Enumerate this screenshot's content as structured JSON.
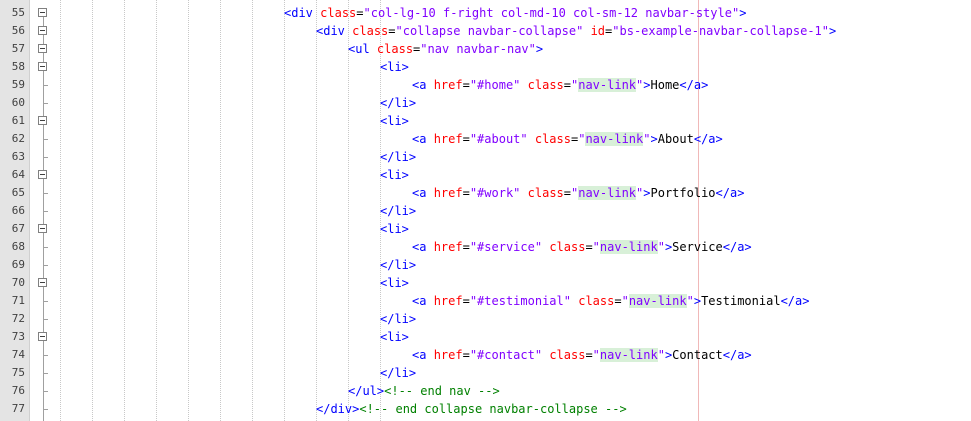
{
  "editor": {
    "lines": [
      {
        "num": "55",
        "fold": "box",
        "indent": 284,
        "html": "<span class='tag'>&lt;div</span> <span class='attr'>class</span><span class='txt'>=</span><span class='val'>\"col-lg-10 f-right col-md-10 col-sm-12 navbar-style\"</span><span class='tag'>&gt;</span>"
      },
      {
        "num": "56",
        "fold": "box",
        "indent": 316,
        "html": "<span class='tag'>&lt;div</span> <span class='attr'>class</span><span class='txt'>=</span><span class='val'>\"collapse navbar-collapse\"</span> <span class='attr'>id</span><span class='txt'>=</span><span class='val'>\"bs-example-navbar-collapse-1\"</span><span class='tag'>&gt;</span>"
      },
      {
        "num": "57",
        "fold": "box",
        "indent": 348,
        "html": "<span class='tag'>&lt;ul</span> <span class='attr'>class</span><span class='txt'>=</span><span class='val'>\"nav navbar-nav\"</span><span class='tag'>&gt;</span>"
      },
      {
        "num": "58",
        "fold": "box",
        "indent": 380,
        "html": "<span class='tag'>&lt;li&gt;</span>"
      },
      {
        "num": "59",
        "fold": "tick",
        "indent": 412,
        "html": "<span class='tag'>&lt;a</span> <span class='attr'>href</span><span class='txt'>=</span><span class='val'>\"#home\"</span> <span class='attr'>class</span><span class='txt'>=</span><span class='val'>\"<span class='hl'>nav-link</span>\"</span><span class='tag'>&gt;</span><span class='txt'>Home</span><span class='tag'>&lt;/a&gt;</span>"
      },
      {
        "num": "60",
        "fold": "tick",
        "indent": 380,
        "html": "<span class='tag'>&lt;/li&gt;</span>"
      },
      {
        "num": "61",
        "fold": "box",
        "indent": 380,
        "html": "<span class='tag'>&lt;li&gt;</span>"
      },
      {
        "num": "62",
        "fold": "tick",
        "indent": 412,
        "html": "<span class='tag'>&lt;a</span> <span class='attr'>href</span><span class='txt'>=</span><span class='val'>\"#about\"</span> <span class='attr'>class</span><span class='txt'>=</span><span class='val'>\"<span class='hl'>nav-link</span>\"</span><span class='tag'>&gt;</span><span class='txt'>About</span><span class='tag'>&lt;/a&gt;</span>"
      },
      {
        "num": "63",
        "fold": "tick",
        "indent": 380,
        "html": "<span class='tag'>&lt;/li&gt;</span>"
      },
      {
        "num": "64",
        "fold": "box",
        "indent": 380,
        "html": "<span class='tag'>&lt;li&gt;</span>"
      },
      {
        "num": "65",
        "fold": "tick",
        "indent": 412,
        "html": "<span class='tag'>&lt;a</span> <span class='attr'>href</span><span class='txt'>=</span><span class='val'>\"#work\"</span> <span class='attr'>class</span><span class='txt'>=</span><span class='val'>\"<span class='hl'>nav-link</span>\"</span><span class='tag'>&gt;</span><span class='txt'>Portfolio</span><span class='tag'>&lt;/a&gt;</span>"
      },
      {
        "num": "66",
        "fold": "tick",
        "indent": 380,
        "html": "<span class='tag'>&lt;/li&gt;</span>"
      },
      {
        "num": "67",
        "fold": "box",
        "indent": 380,
        "html": "<span class='tag'>&lt;li&gt;</span>"
      },
      {
        "num": "68",
        "fold": "tick",
        "indent": 412,
        "html": "<span class='tag'>&lt;a</span> <span class='attr'>href</span><span class='txt'>=</span><span class='val'>\"#service\"</span> <span class='attr'>class</span><span class='txt'>=</span><span class='val'>\"<span class='hl'>nav-link</span>\"</span><span class='tag'>&gt;</span><span class='txt'>Service</span><span class='tag'>&lt;/a&gt;</span>"
      },
      {
        "num": "69",
        "fold": "tick",
        "indent": 380,
        "html": "<span class='tag'>&lt;/li&gt;</span>"
      },
      {
        "num": "70",
        "fold": "box",
        "indent": 380,
        "html": "<span class='tag'>&lt;li&gt;</span>"
      },
      {
        "num": "71",
        "fold": "tick",
        "indent": 412,
        "html": "<span class='tag'>&lt;a</span> <span class='attr'>href</span><span class='txt'>=</span><span class='val'>\"#testimonial\"</span> <span class='attr'>class</span><span class='txt'>=</span><span class='val'>\"<span class='hl'>nav-link</span>\"</span><span class='tag'>&gt;</span><span class='txt'>Testimonial</span><span class='tag'>&lt;/a&gt;</span>"
      },
      {
        "num": "72",
        "fold": "tick",
        "indent": 380,
        "html": "<span class='tag'>&lt;/li&gt;</span>"
      },
      {
        "num": "73",
        "fold": "box",
        "indent": 380,
        "html": "<span class='tag'>&lt;li&gt;</span>"
      },
      {
        "num": "74",
        "fold": "tick",
        "indent": 412,
        "html": "<span class='tag'>&lt;a</span> <span class='attr'>href</span><span class='txt'>=</span><span class='val'>\"#contact\"</span> <span class='attr'>class</span><span class='txt'>=</span><span class='val'>\"<span class='hl'>nav-link</span>\"</span><span class='tag'>&gt;</span><span class='txt'>Contact</span><span class='tag'>&lt;/a&gt;</span>"
      },
      {
        "num": "75",
        "fold": "tick",
        "indent": 380,
        "html": "<span class='tag'>&lt;/li&gt;</span>"
      },
      {
        "num": "76",
        "fold": "tick",
        "indent": 348,
        "html": "<span class='tag'>&lt;/ul&gt;</span><span class='cmt'>&lt;!-- end nav --&gt;</span>"
      },
      {
        "num": "77",
        "fold": "tick",
        "indent": 316,
        "html": "<span class='tag'>&lt;/div&gt;</span><span class='cmt'>&lt;!-- end collapse navbar-collapse --&gt;</span>"
      }
    ]
  },
  "colors": {
    "tag": "#0000ff",
    "attribute": "#ff0000",
    "value": "#8000ff",
    "comment": "#008000",
    "text": "#000000",
    "gutter": "#e4e4e4",
    "highlight": "#d8f0d8",
    "edge_marker": "#f0b8b8"
  },
  "icons": {
    "fold": "fold-minus-icon"
  }
}
